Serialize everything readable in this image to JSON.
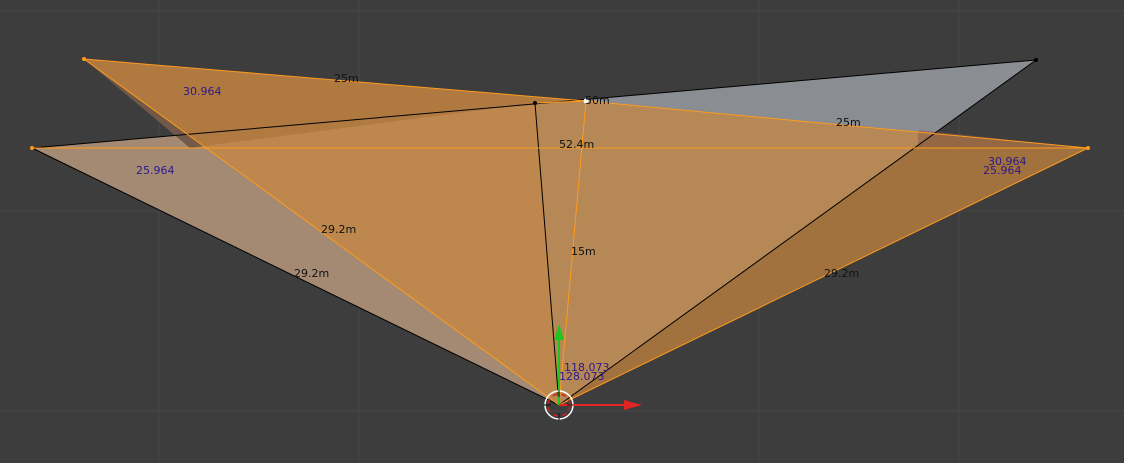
{
  "viewport": {
    "background": "#3d3d3d",
    "grid_color": "#474747",
    "colors": {
      "selected_edge": "#ff9a1e",
      "unselected_edge": "#000000",
      "selected_face": "#c8873e",
      "unselected_face": "#8e9197",
      "length_label": "#111111",
      "angle_label": "#2a1a8a",
      "axis_x": "#e02424",
      "axis_y": "#22c422"
    },
    "edge_length_labels": {
      "top_left_edge": "25m",
      "top_right_edge": "25m",
      "middle_short_edge": "50m",
      "horizontal_edge": "52.4m",
      "inner_left_edge": "29.2m",
      "outer_left_edge": "29.2m",
      "right_edge": "29.2m",
      "center_edge": "15m"
    },
    "face_angle_labels": {
      "top_left": "30.964",
      "left": "25.964",
      "right_top": "30.964",
      "right_bottom": "25.964",
      "bottom_a": "118.073",
      "bottom_b": "128.073"
    },
    "gizmo": {
      "icon": "3d-cursor-icon",
      "x_axis_icon": "x-axis-arrow-icon",
      "y_axis_icon": "y-axis-arrow-icon"
    }
  }
}
